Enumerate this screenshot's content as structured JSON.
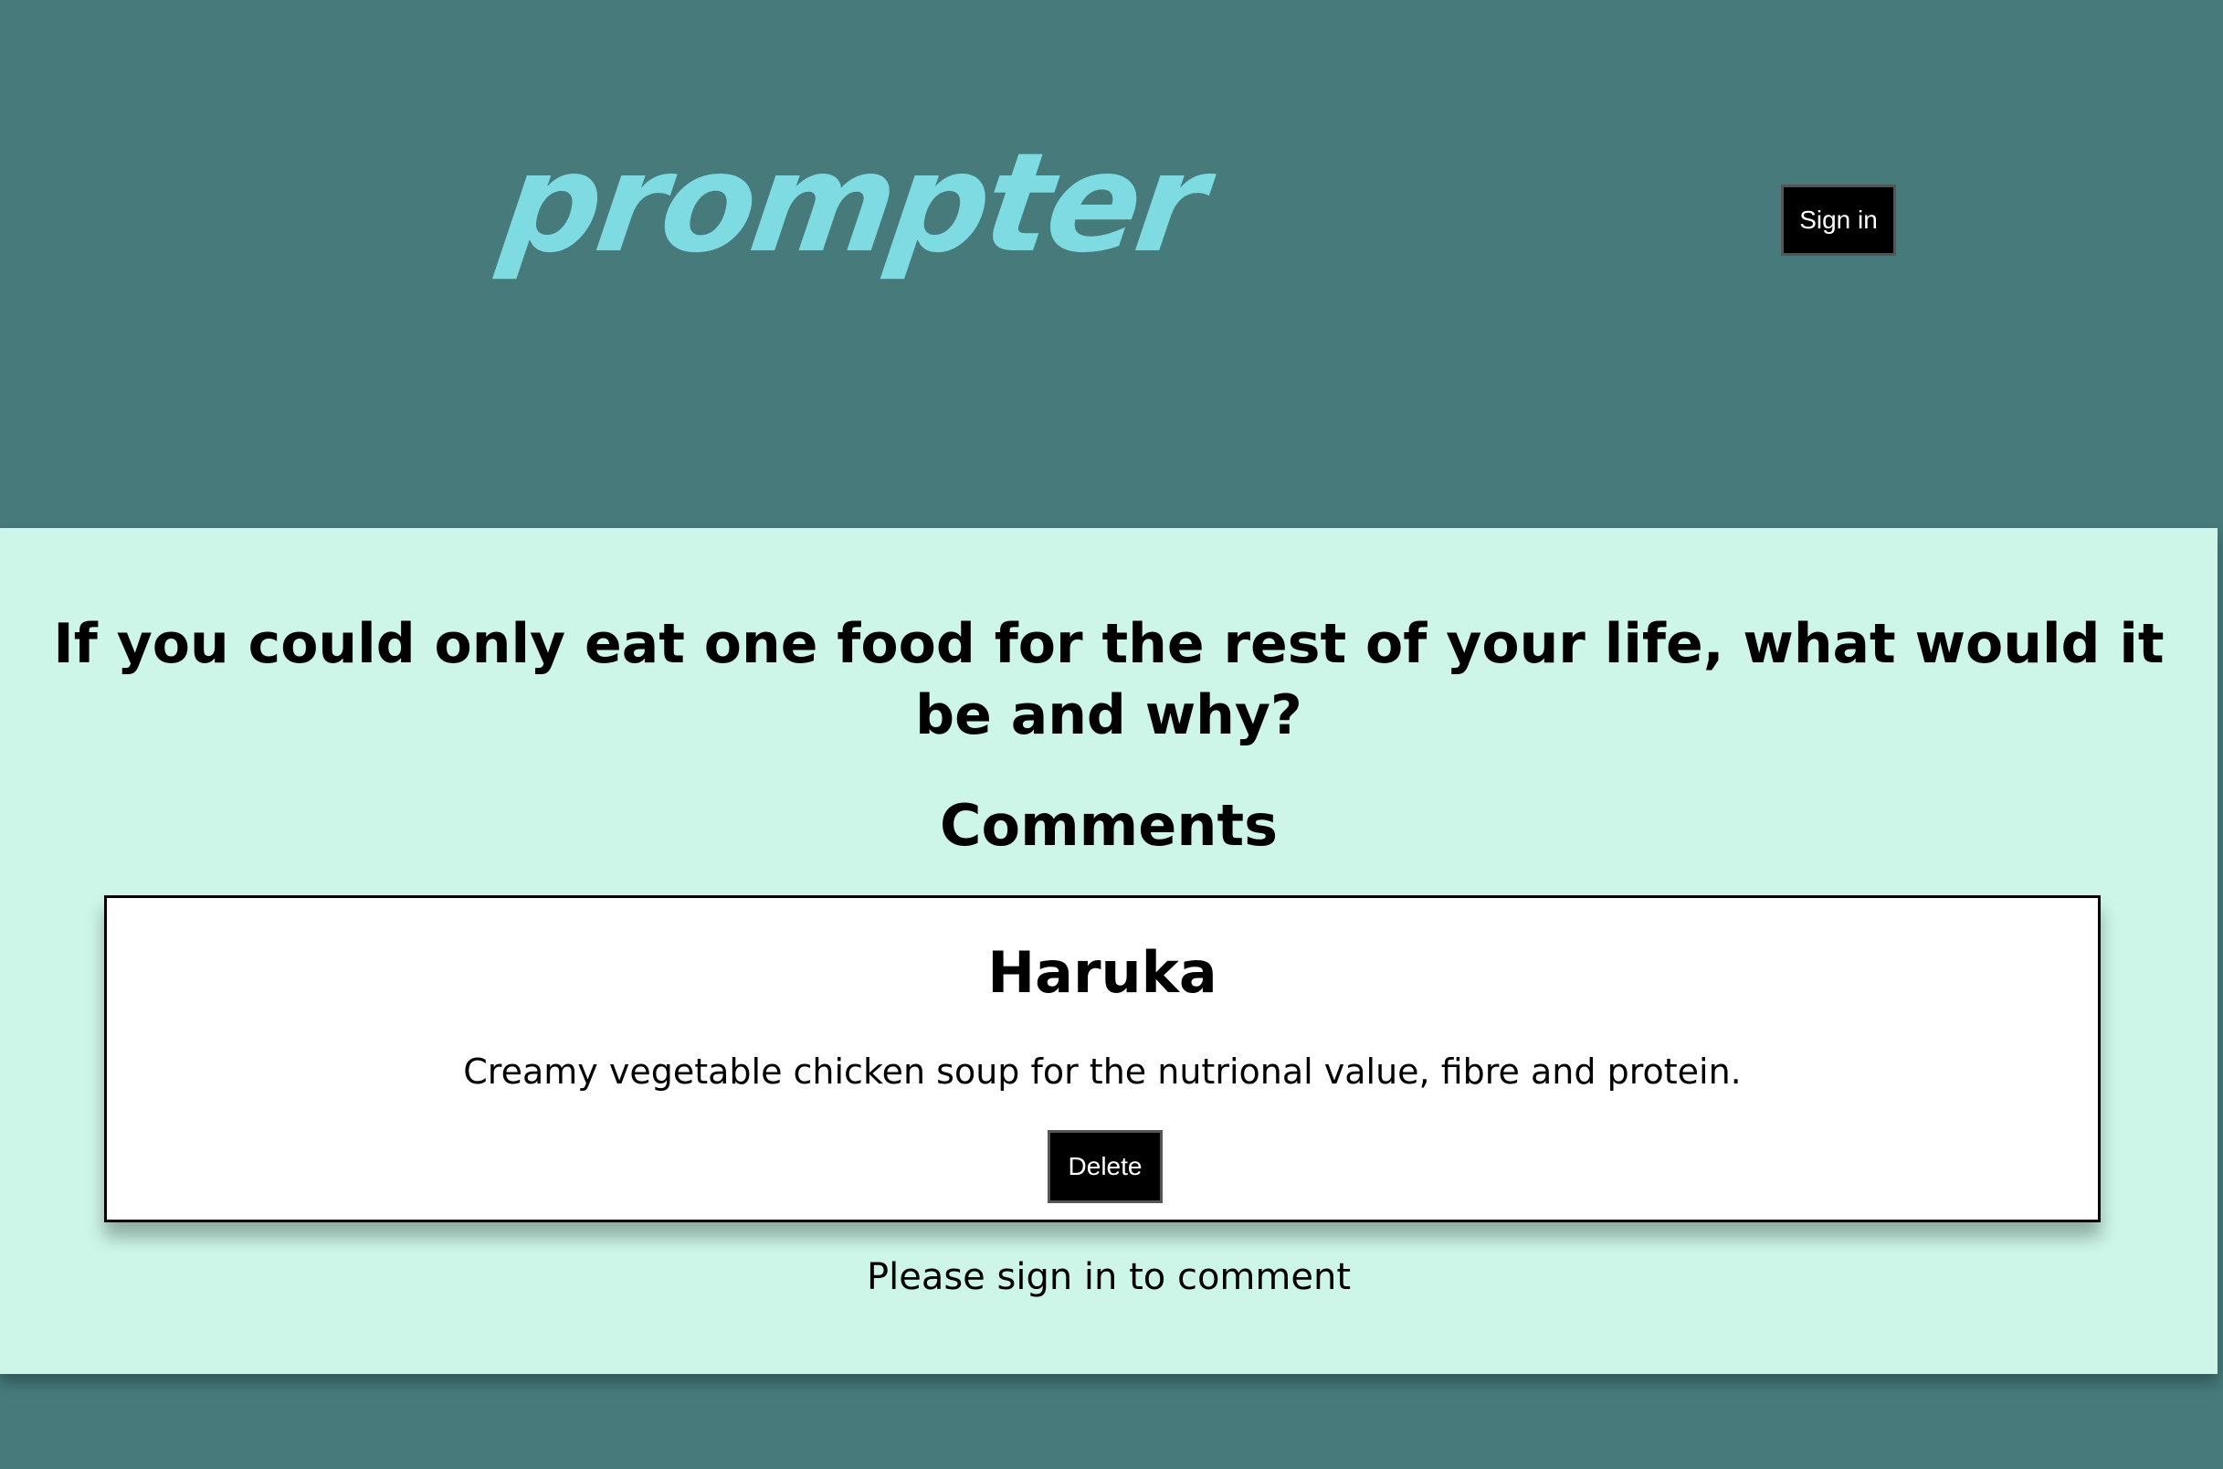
{
  "colors": {
    "page_background": "#467a7b",
    "content_background": "#cdf6e8",
    "logo_color": "#7fdbe2",
    "button_background": "#000000"
  },
  "header": {
    "logo_text": "prompter",
    "signin_label": "Sign in"
  },
  "main": {
    "question": "If you could only eat one food for the rest of your life, what would it be and why?",
    "comments_heading": "Comments",
    "comments": [
      {
        "author": "Haruka",
        "text": "Creamy vegetable chicken soup for the nutrional value, fibre and protein.",
        "delete_label": "Delete"
      }
    ],
    "signin_prompt": "Please sign in to comment"
  }
}
